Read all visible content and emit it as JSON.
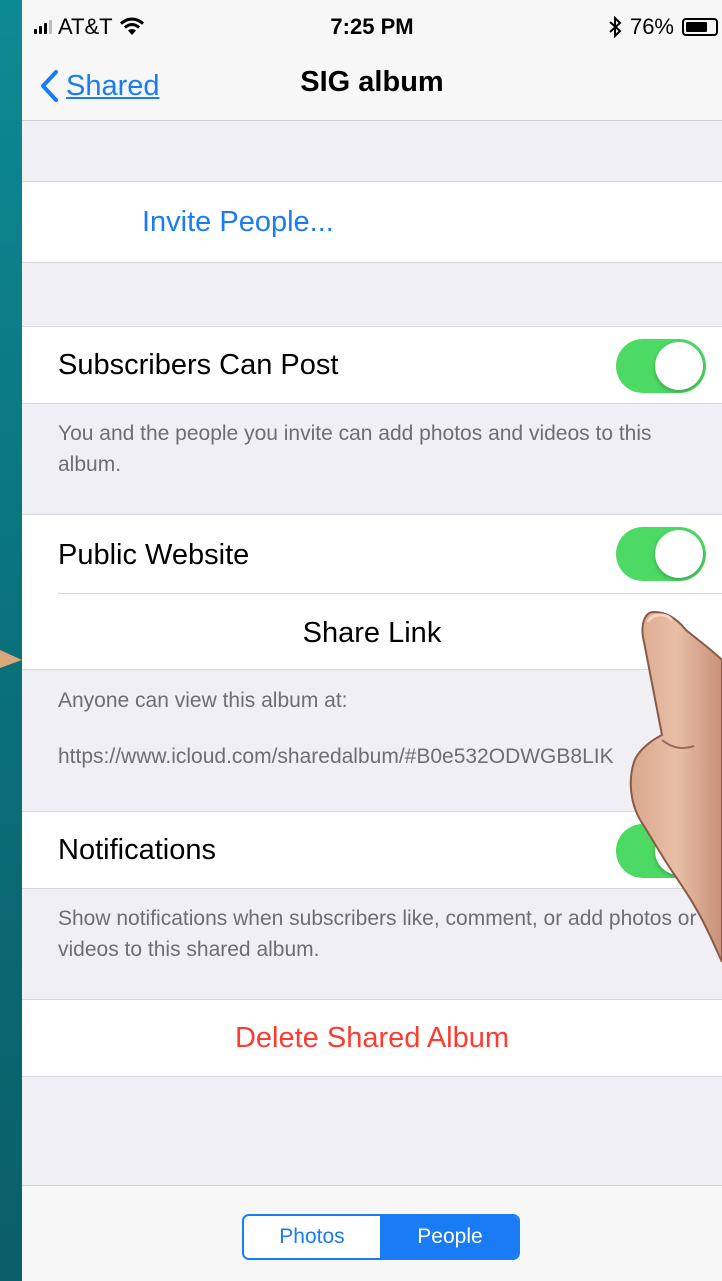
{
  "status_bar": {
    "carrier": "AT&T",
    "time": "7:25 PM",
    "battery_percent": "76%",
    "battery_level": 0.76
  },
  "nav": {
    "back_label": "Shared",
    "title": "SIG album"
  },
  "invite": {
    "label": "Invite People..."
  },
  "subscribers_can_post": {
    "label": "Subscribers Can Post",
    "enabled": true,
    "footer": "You and the people you invite can add photos and videos to this album."
  },
  "public_website": {
    "label": "Public Website",
    "enabled": true,
    "share_link_label": "Share Link",
    "footer_line1": "Anyone can view this album at:",
    "url": "https://www.icloud.com/sharedalbum/#B0e532ODWGB8LIK"
  },
  "notifications": {
    "label": "Notifications",
    "enabled": true,
    "footer": "Show notifications when subscribers like, comment, or add photos or videos to this shared album."
  },
  "delete": {
    "label": "Delete Shared Album"
  },
  "segmented": {
    "photos_label": "Photos",
    "people_label": "People",
    "selected": "People"
  },
  "colors": {
    "accent": "#1a7cf4",
    "toggle_on": "#4cd964",
    "destructive": "#ff3b30",
    "background": "#efeff4"
  },
  "icons": {
    "back": "chevron-left-icon",
    "wifi": "wifi-icon",
    "bluetooth": "bluetooth-icon",
    "battery": "battery-icon",
    "signal": "signal-icon"
  }
}
